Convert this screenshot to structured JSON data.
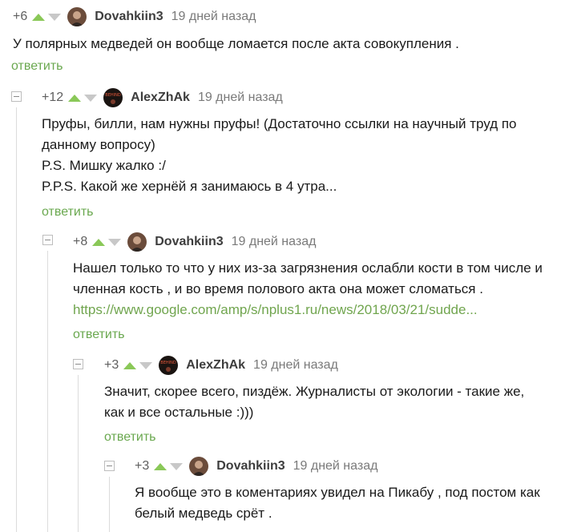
{
  "comments": [
    {
      "rating": "+6",
      "author": "Dovahkiin3",
      "time": "19 дней назад",
      "lines": [
        "У полярных медведей он вообще ломается после акта совокупления ."
      ],
      "reply": "ответить"
    },
    {
      "rating": "+12",
      "author": "AlexZhAk",
      "time": "19 дней назад",
      "lines": [
        "Пруфы, билли, нам нужны пруфы! (Достаточно ссылки на научный труд по",
        "данному вопросу)",
        "P.S. Мишку жалко :/",
        "P.P.S. Какой же хернёй я занимаюсь в 4 утра..."
      ],
      "reply": "ответить"
    },
    {
      "rating": "+8",
      "author": "Dovahkiin3",
      "time": "19 дней назад",
      "lines": [
        "Нашел только то что у них из-за загрязнения ослабли кости в том числе и",
        "членная кость , и во время полового акта она может сломаться ."
      ],
      "link": "https://www.google.com/amp/s/nplus1.ru/news/2018/03/21/sudde...",
      "reply": "ответить"
    },
    {
      "rating": "+3",
      "author": "AlexZhAk",
      "time": "19 дней назад",
      "lines": [
        "Значит, скорее всего, пиздёж. Журналисты от экологии - такие же,",
        "как и все остальные :)))"
      ],
      "reply": "ответить"
    },
    {
      "rating": "+3",
      "author": "Dovahkiin3",
      "time": "19 дней назад",
      "lines": [
        "Я вообще это в коментариях увидел на Пикабу , под постом как",
        "белый медведь срёт ."
      ]
    }
  ],
  "avatar_text": "BEHIND",
  "colors": {
    "vote_up": "#8ac858",
    "vote_down": "#c8c8c8",
    "reply": "#6aa84f",
    "link": "#70a54e"
  },
  "icons": {
    "collapse": "minus-box-icon",
    "vote_up": "triangle-up-icon",
    "vote_down": "triangle-down-icon"
  }
}
